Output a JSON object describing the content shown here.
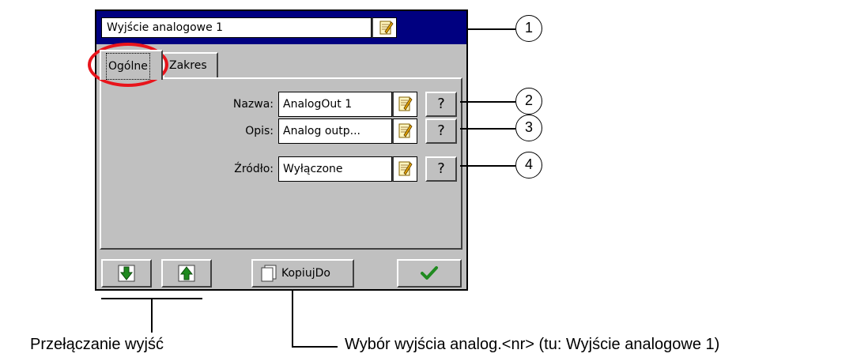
{
  "window": {
    "title_field": "Wyjście analogowe 1",
    "tabs": [
      {
        "label": "Ogólne",
        "active": true
      },
      {
        "label": "Zakres",
        "active": false
      }
    ]
  },
  "fields": [
    {
      "label": "Nazwa:",
      "value": "AnalogOut 1",
      "help": "?"
    },
    {
      "label": "Opis:",
      "value": "Analog outp...",
      "help": "?"
    },
    {
      "label": "Źródło:",
      "value": "Wyłączone",
      "help": "?"
    }
  ],
  "bottom_bar": {
    "copy_label": "KopiujDo"
  },
  "callouts": [
    "1",
    "2",
    "3",
    "4"
  ],
  "captions": {
    "switch_outputs": "Przełączanie wyjść",
    "select_output": "Wybór wyjścia analog.<nr> (tu: Wyjście analogowe 1)"
  },
  "colors": {
    "titlebar": "#000080",
    "window_bg": "#c0c0c0",
    "highlight_oval": "#e8141b",
    "arrow_green": "#1f8a1f"
  },
  "icons": {
    "edit": "notepad-edit-icon",
    "help": "question-mark-icon",
    "down": "arrow-down-icon",
    "up": "arrow-up-icon",
    "copy": "copy-page-icon",
    "ok": "checkmark-icon"
  }
}
